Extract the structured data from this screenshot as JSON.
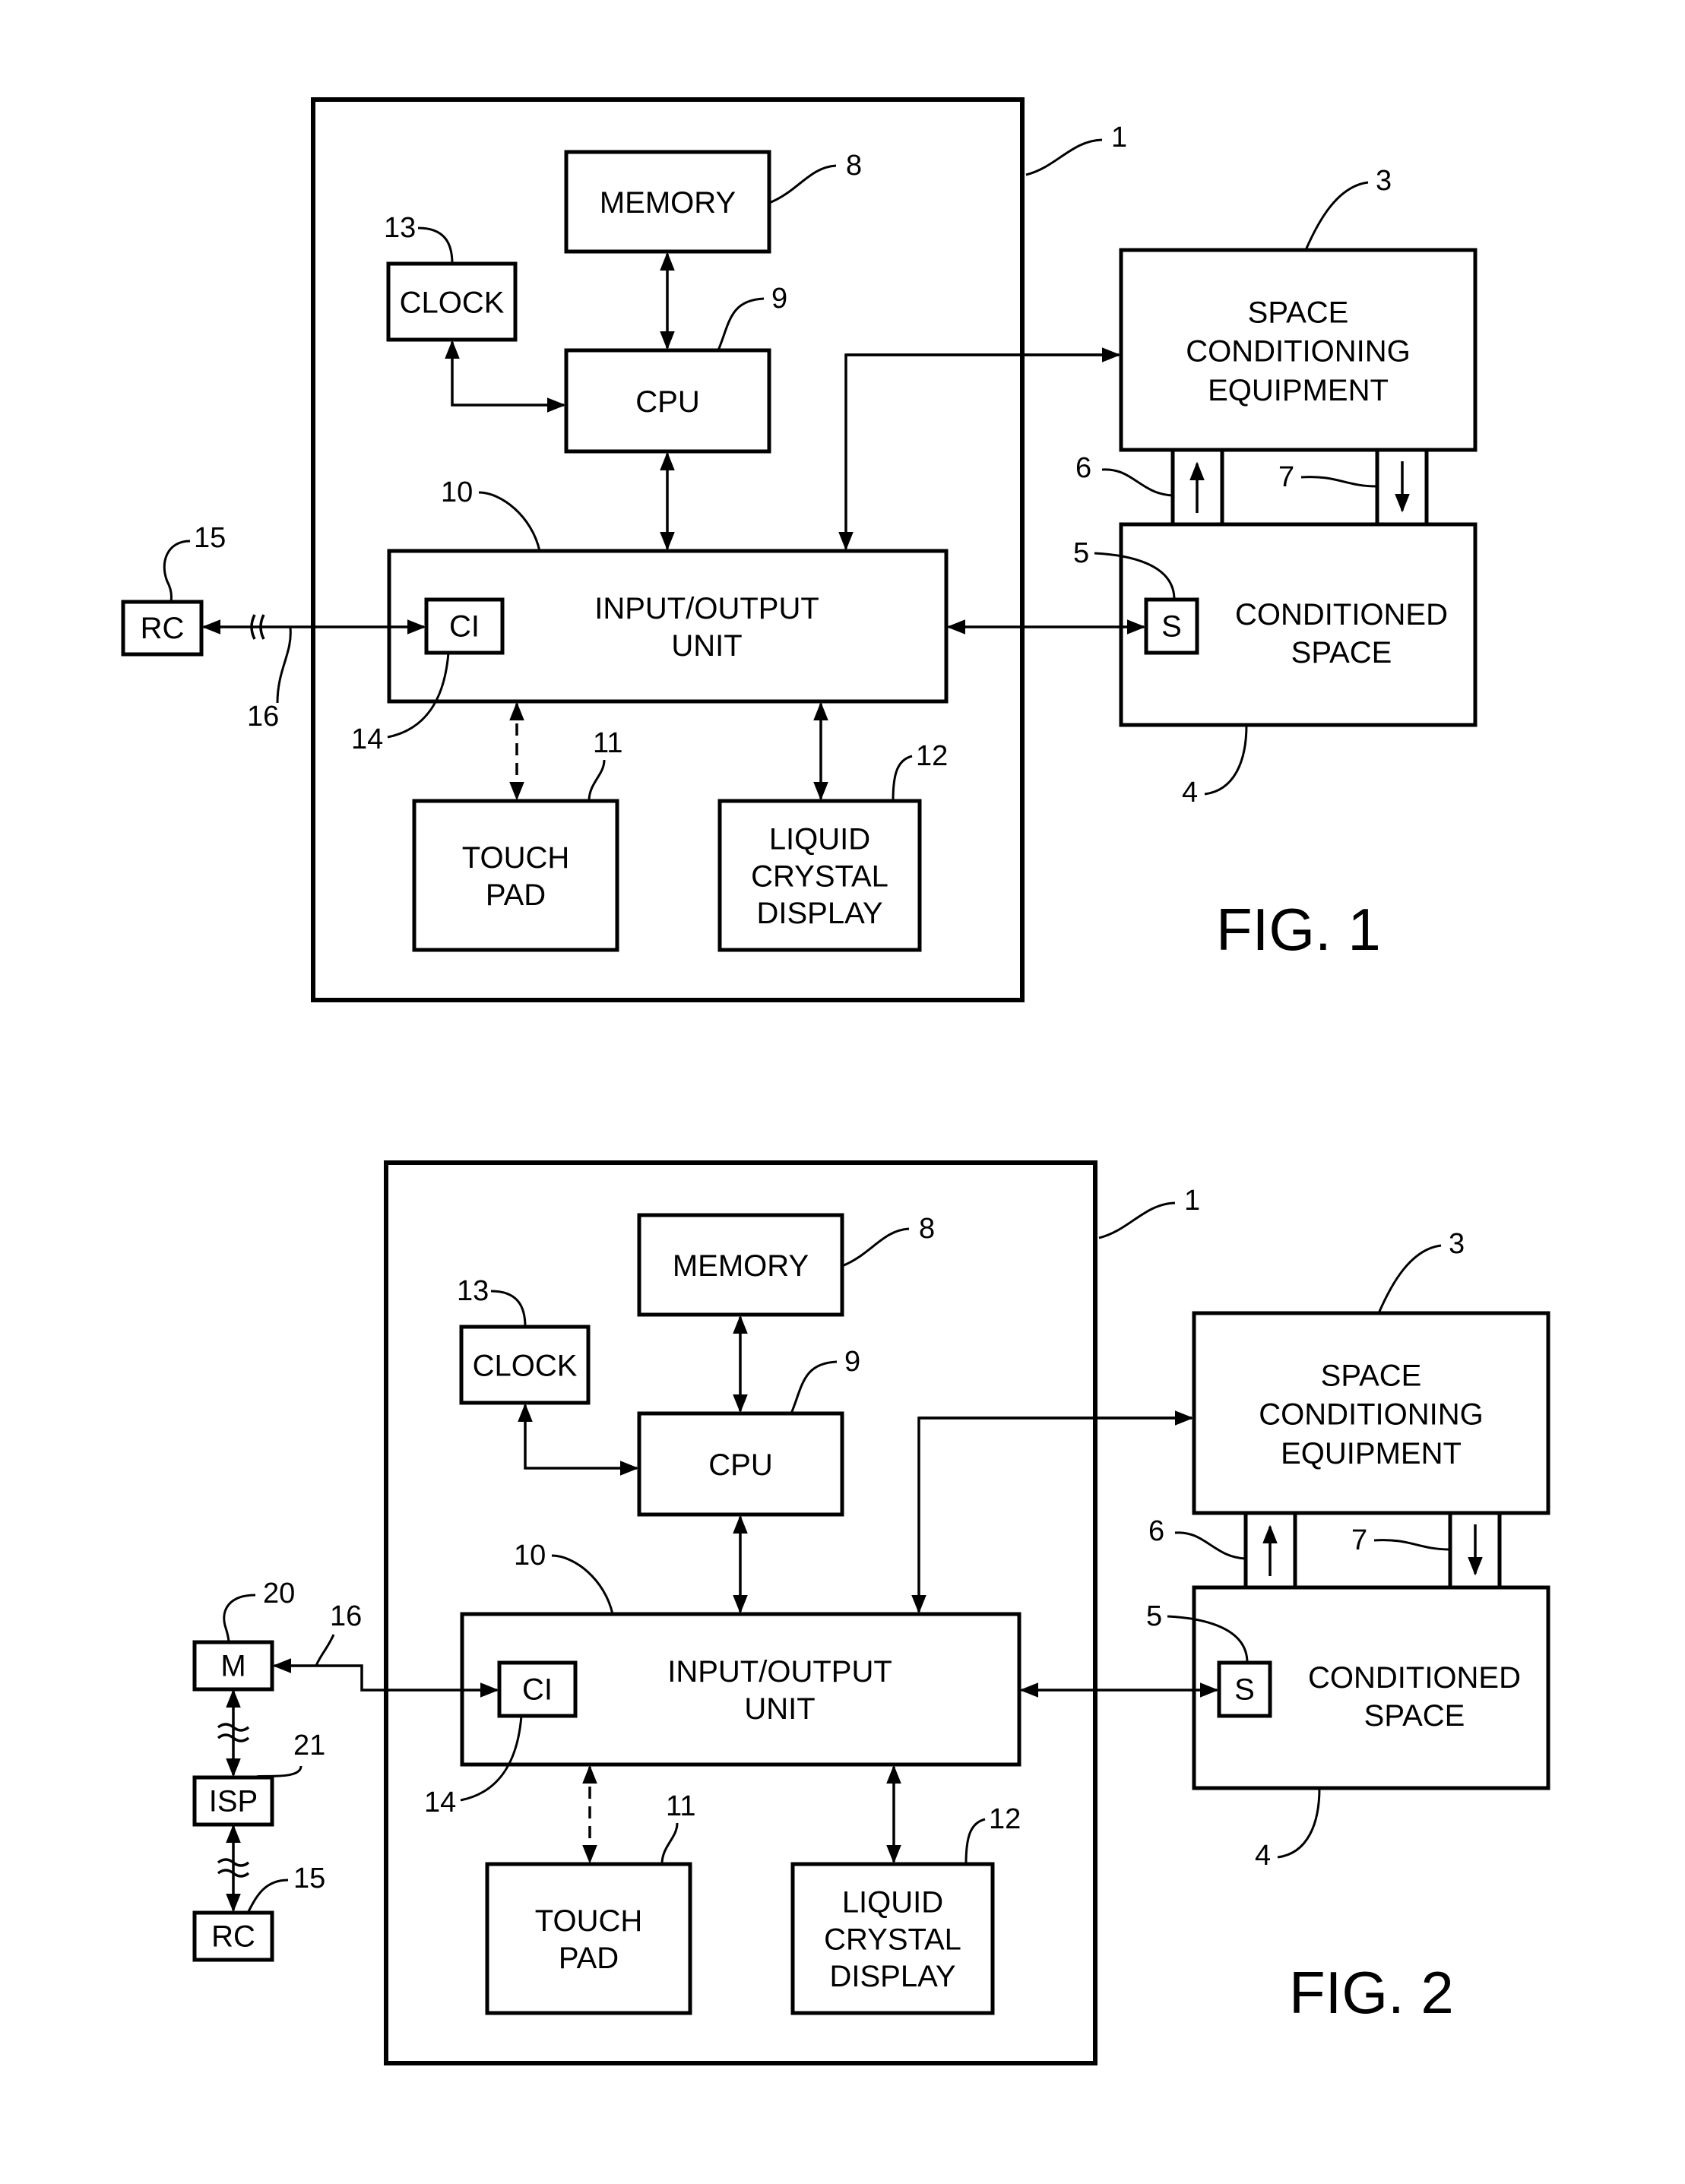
{
  "figures": [
    {
      "caption": "FIG. 1",
      "blocks": {
        "memory": [
          "MEMORY"
        ],
        "clock": [
          "CLOCK"
        ],
        "cpu": [
          "CPU"
        ],
        "io": [
          "INPUT/OUTPUT",
          "UNIT"
        ],
        "ci": [
          "CI"
        ],
        "touchpad": [
          "TOUCH",
          "PAD"
        ],
        "lcd": [
          "LIQUID",
          "CRYSTAL",
          "DISPLAY"
        ],
        "sce": [
          "SPACE",
          "CONDITIONING",
          "EQUIPMENT"
        ],
        "space": [
          "CONDITIONED",
          "SPACE"
        ],
        "sensor": [
          "S"
        ],
        "rc": [
          "RC"
        ]
      },
      "refs": {
        "thermostat": "1",
        "sce": "3",
        "space": "4",
        "sensor": "5",
        "duct_supply": "6",
        "duct_return": "7",
        "memory": "8",
        "cpu": "9",
        "io": "10",
        "touchpad": "11",
        "lcd": "12",
        "clock": "13",
        "ci": "14",
        "rc": "15",
        "link": "16"
      }
    },
    {
      "caption": "FIG. 2",
      "blocks": {
        "memory": [
          "MEMORY"
        ],
        "clock": [
          "CLOCK"
        ],
        "cpu": [
          "CPU"
        ],
        "io": [
          "INPUT/OUTPUT",
          "UNIT"
        ],
        "ci": [
          "CI"
        ],
        "touchpad": [
          "TOUCH",
          "PAD"
        ],
        "lcd": [
          "LIQUID",
          "CRYSTAL",
          "DISPLAY"
        ],
        "sce": [
          "SPACE",
          "CONDITIONING",
          "EQUIPMENT"
        ],
        "space": [
          "CONDITIONED",
          "SPACE"
        ],
        "sensor": [
          "S"
        ],
        "modem": [
          "M"
        ],
        "isp": [
          "ISP"
        ],
        "rc": [
          "RC"
        ]
      },
      "refs": {
        "thermostat": "1",
        "sce": "3",
        "space": "4",
        "sensor": "5",
        "duct_supply": "6",
        "duct_return": "7",
        "memory": "8",
        "cpu": "9",
        "io": "10",
        "touchpad": "11",
        "lcd": "12",
        "clock": "13",
        "ci": "14",
        "rc": "15",
        "link": "16",
        "modem": "20",
        "isp": "21"
      }
    }
  ]
}
